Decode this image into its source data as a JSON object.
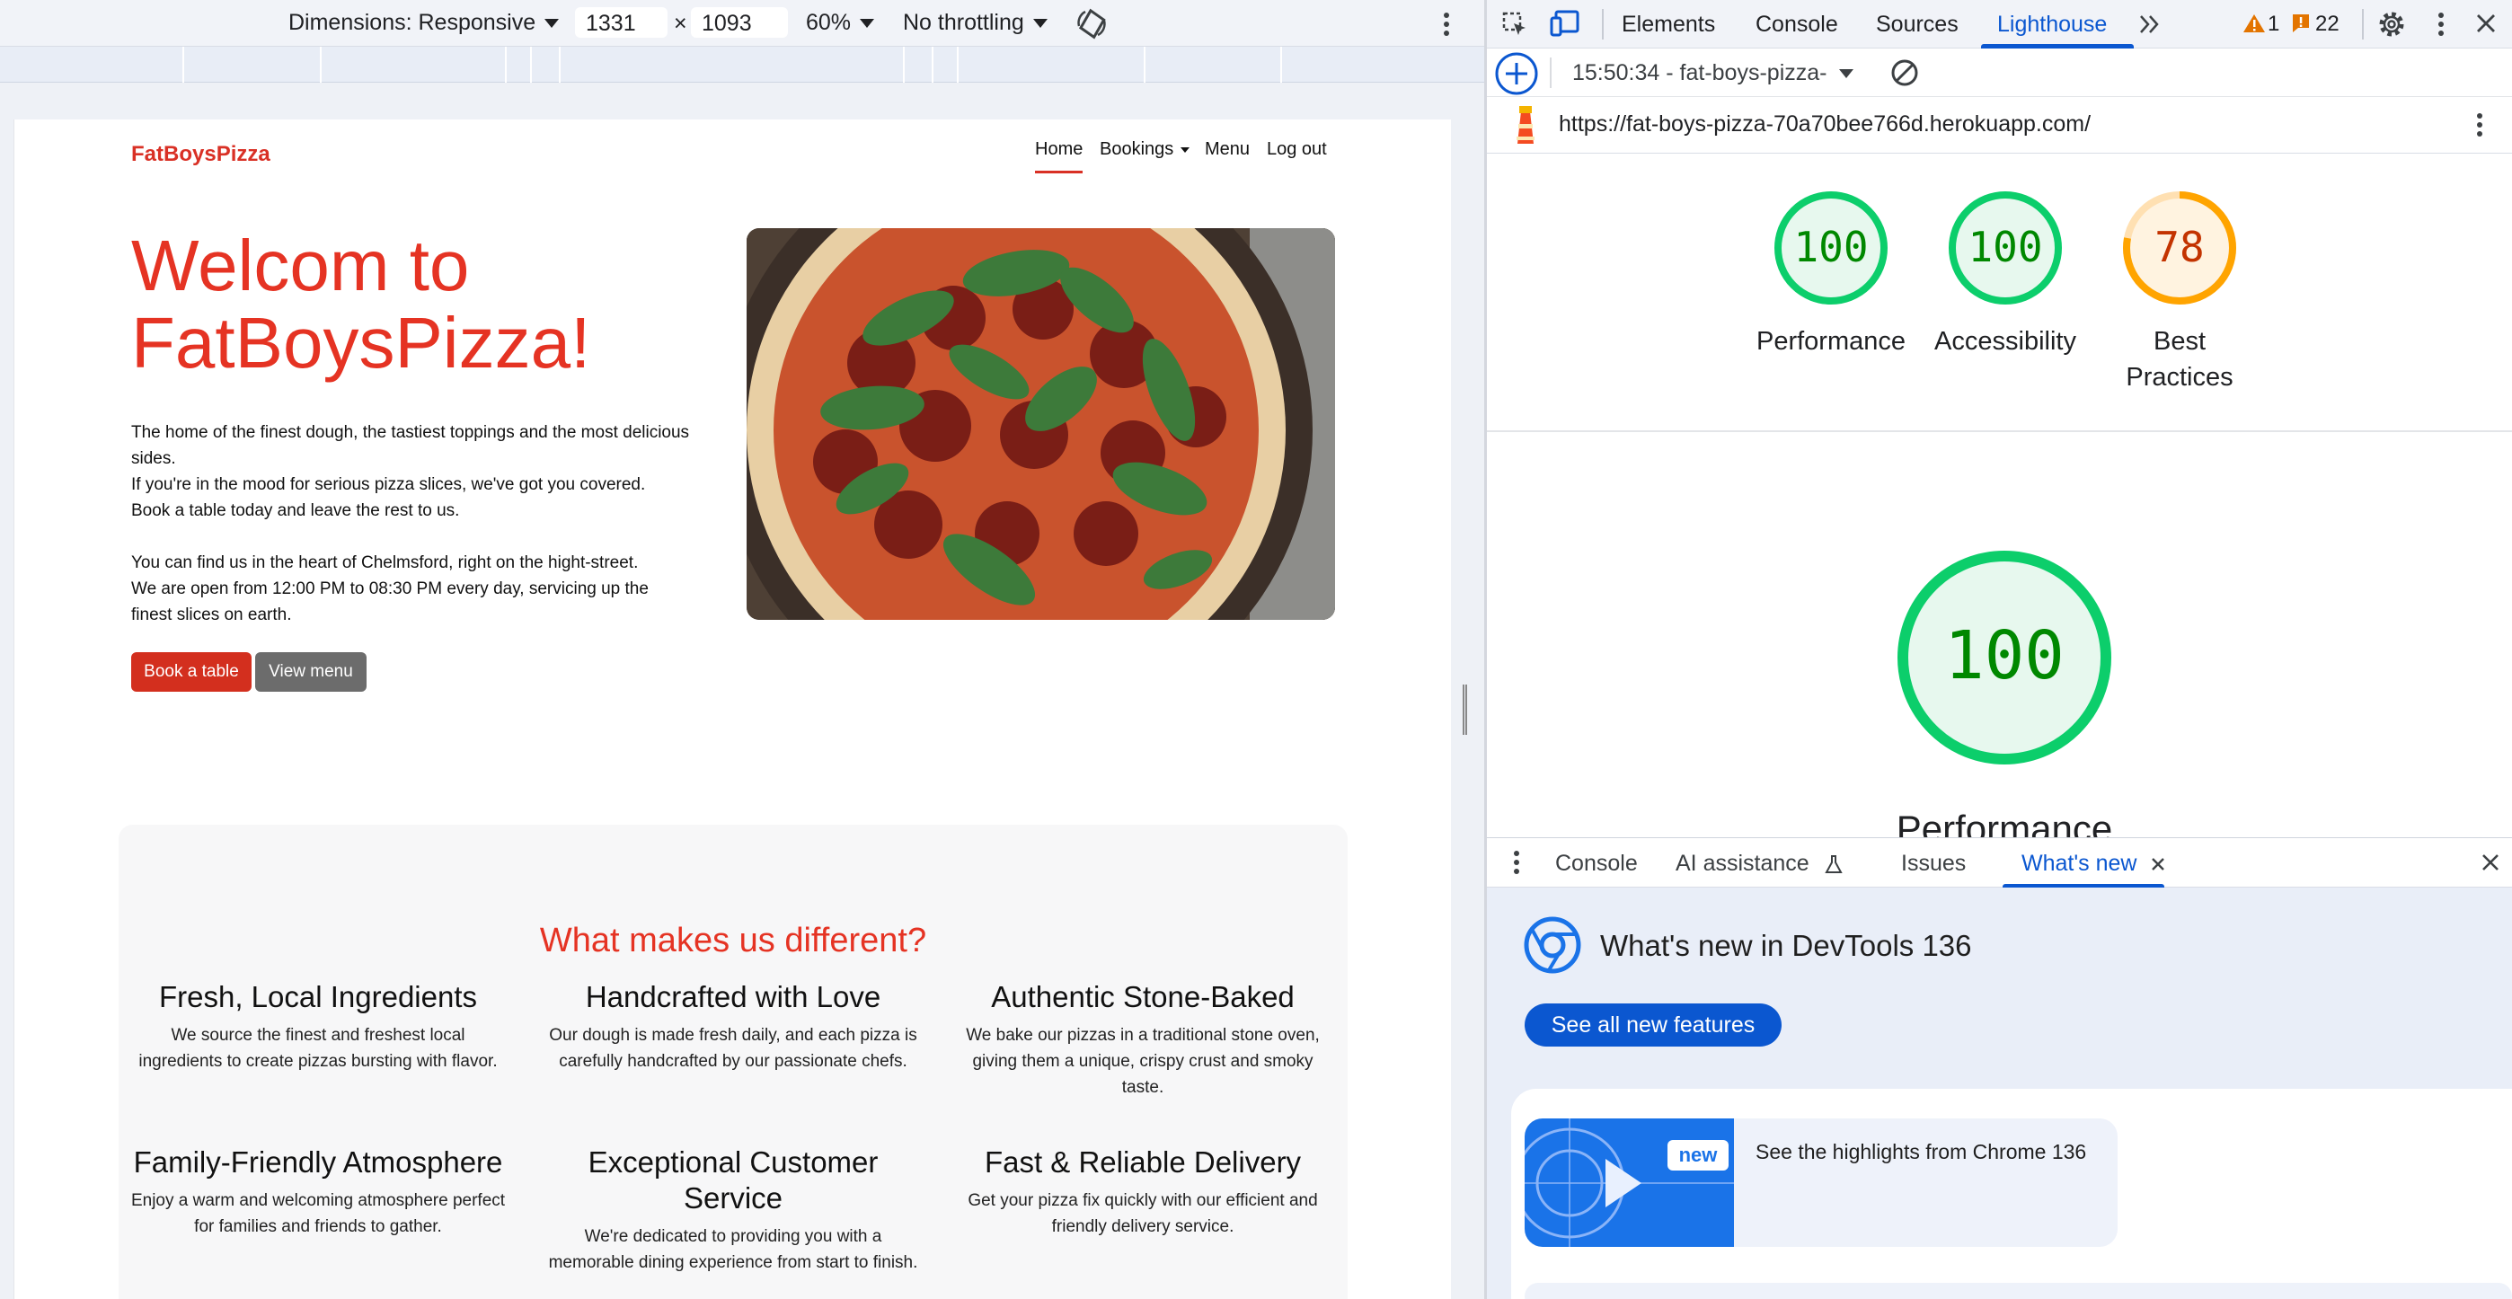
{
  "device_toolbar": {
    "dimensions_label": "Dimensions: Responsive",
    "width": "1331",
    "times": "×",
    "height": "1093",
    "zoom": "60%",
    "throttling": "No throttling",
    "rotate_icon": "rotate-icon",
    "more_icon": "more-vert-icon"
  },
  "site": {
    "brand": "FatBoysPizza",
    "nav": {
      "home": "Home",
      "bookings": "Bookings",
      "menu": "Menu",
      "logout": "Log out"
    },
    "hero": {
      "title_line1": "Welcom to",
      "title_line2": "FatBoysPizza!",
      "para1_line1": "The home of the finest dough, the tastiest toppings and the most delicious",
      "para1_line2": "sides.",
      "para1_line3": "If you're in the mood for serious pizza slices, we've got you covered.",
      "para1_line4": "Book a table today and leave the rest to us.",
      "para2_line1": "You can find us in the heart of Chelmsford, right on the hight-street.",
      "para2_line2": "We are open from 12:00 PM to 08:30 PM every day, servicing up the",
      "para2_line3": "finest slices on earth.",
      "book_btn": "Book a table",
      "menu_btn": "View menu"
    },
    "features": {
      "heading": "What makes us different?",
      "items": [
        {
          "title": "Fresh, Local Ingredients",
          "text_l1": "We source the finest and freshest local",
          "text_l2": "ingredients to create pizzas bursting with flavor.",
          "text_l3": ""
        },
        {
          "title": "Handcrafted with Love",
          "text_l1": "Our dough is made fresh daily, and each pizza is",
          "text_l2": "carefully handcrafted by our passionate chefs.",
          "text_l3": ""
        },
        {
          "title": "Authentic Stone-Baked",
          "text_l1": "We bake our pizzas in a traditional stone oven,",
          "text_l2": "giving them a unique, crispy crust and smoky",
          "text_l3": "taste."
        },
        {
          "title": "Family-Friendly Atmosphere",
          "text_l1": "Enjoy a warm and welcoming atmosphere perfect",
          "text_l2": "for families and friends to gather.",
          "text_l3": ""
        },
        {
          "title_l1": "Exceptional Customer",
          "title_l2": "Service",
          "text_l1": "We're dedicated to providing you with a",
          "text_l2": "memorable dining experience from start to finish.",
          "text_l3": ""
        },
        {
          "title": "Fast & Reliable Delivery",
          "text_l1": "Get your pizza fix quickly with our efficient and",
          "text_l2": "friendly delivery service.",
          "text_l3": ""
        }
      ]
    }
  },
  "devtools": {
    "tabs": [
      "Elements",
      "Console",
      "Sources",
      "Lighthouse"
    ],
    "selected_tab": "Lighthouse",
    "warnings": "1",
    "issues": "22",
    "report_label": "15:50:34 - fat-boys-pizza-",
    "url": "https://fat-boys-pizza-70a70bee766d.herokuapp.com/",
    "scores": [
      {
        "label": "Performance",
        "value": 100
      },
      {
        "label": "Accessibility",
        "value": 100
      },
      {
        "label_l1": "Best",
        "label_l2": "Practices",
        "value": 78
      }
    ],
    "big_score": {
      "value": 100,
      "label": "Performance"
    },
    "colors": {
      "pass": "#0cce6b",
      "average": "#ffa400",
      "pass_text": "#008800",
      "average_text": "#c33300"
    },
    "drawer": {
      "tabs": [
        "Console",
        "AI assistance",
        "Issues",
        "What's new"
      ],
      "selected": "What's new",
      "title": "What's new in DevTools 136",
      "see_all": "See all new features",
      "badge": "new",
      "highlight": "See the highlights from Chrome 136"
    }
  }
}
